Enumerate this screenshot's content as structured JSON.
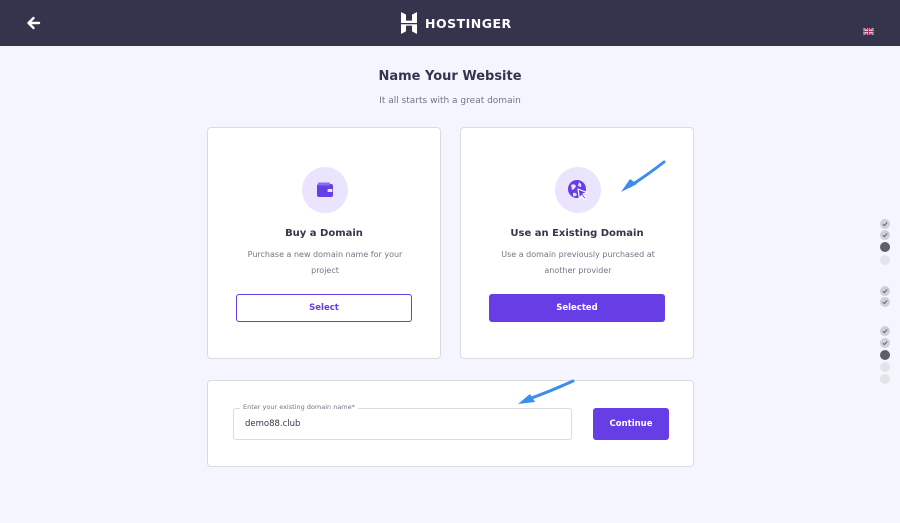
{
  "header": {
    "brand": "HOSTINGER",
    "back_icon": "arrow-left-icon",
    "language_icon": "uk-flag-icon"
  },
  "page": {
    "title": "Name Your Website",
    "subtitle": "It all starts with a great domain"
  },
  "options": [
    {
      "title": "Buy a Domain",
      "description": "Purchase a new domain name for your project",
      "button_label": "Select",
      "icon": "wallet-icon",
      "selected": false
    },
    {
      "title": "Use an Existing Domain",
      "description": "Use a domain previously purchased at another provider",
      "button_label": "Selected",
      "icon": "globe-cursor-icon",
      "selected": true
    }
  ],
  "domain_form": {
    "field_label": "Enter your existing domain name*",
    "field_value": "demo88.club",
    "continue_label": "Continue"
  },
  "progress_steps": [
    "done",
    "done",
    "current",
    "todo",
    "done",
    "done",
    "done",
    "done",
    "current",
    "todo",
    "todo"
  ],
  "colors": {
    "brand_purple": "#673de6",
    "header_bg": "#36344d",
    "page_bg": "#f4f5ff",
    "annotation_arrow": "#3d8cf0"
  }
}
